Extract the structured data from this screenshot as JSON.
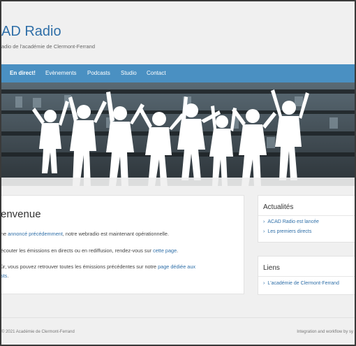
{
  "header": {
    "title": "AD Radio",
    "subtitle": "adio de l'académie de Clermont-Ferrand"
  },
  "nav": {
    "items": [
      {
        "label": "En direct!",
        "active": true
      },
      {
        "label": "Evènements"
      },
      {
        "label": "Podcasts"
      },
      {
        "label": "Studio"
      },
      {
        "label": "Contact"
      }
    ]
  },
  "main": {
    "title": "envenue",
    "p1_pre": "ne ",
    "p1_link": "annoncé précédemment",
    "p1_post": ", notre webradio est maintenant opérationnelle.",
    "p2_pre": "écouter les émissions en directs ou en rediffusion, rendez-vous sur ",
    "p2_link": "cette page",
    "p2_post": ".",
    "p3_pre": "ûr, vous pouvez retrouver toutes les émissions précédentes sur notre ",
    "p3_link": "page dédiée aux",
    "p3_line2_link": "sts",
    "p3_line2_post": "."
  },
  "sidebar": {
    "news_title": "Actualités",
    "news_links": [
      "ACAD Radio est lancée",
      "Les premiers directs"
    ],
    "links_title": "Liens",
    "links": [
      "L'académie de Clermont-Ferrand"
    ]
  },
  "footer": {
    "left": "© 2021 Académie de Clermont-Ferrand",
    "right": "Integration and workflow by sy"
  },
  "colors": {
    "nav": "#4a90c2",
    "link": "#2f6fa8"
  }
}
